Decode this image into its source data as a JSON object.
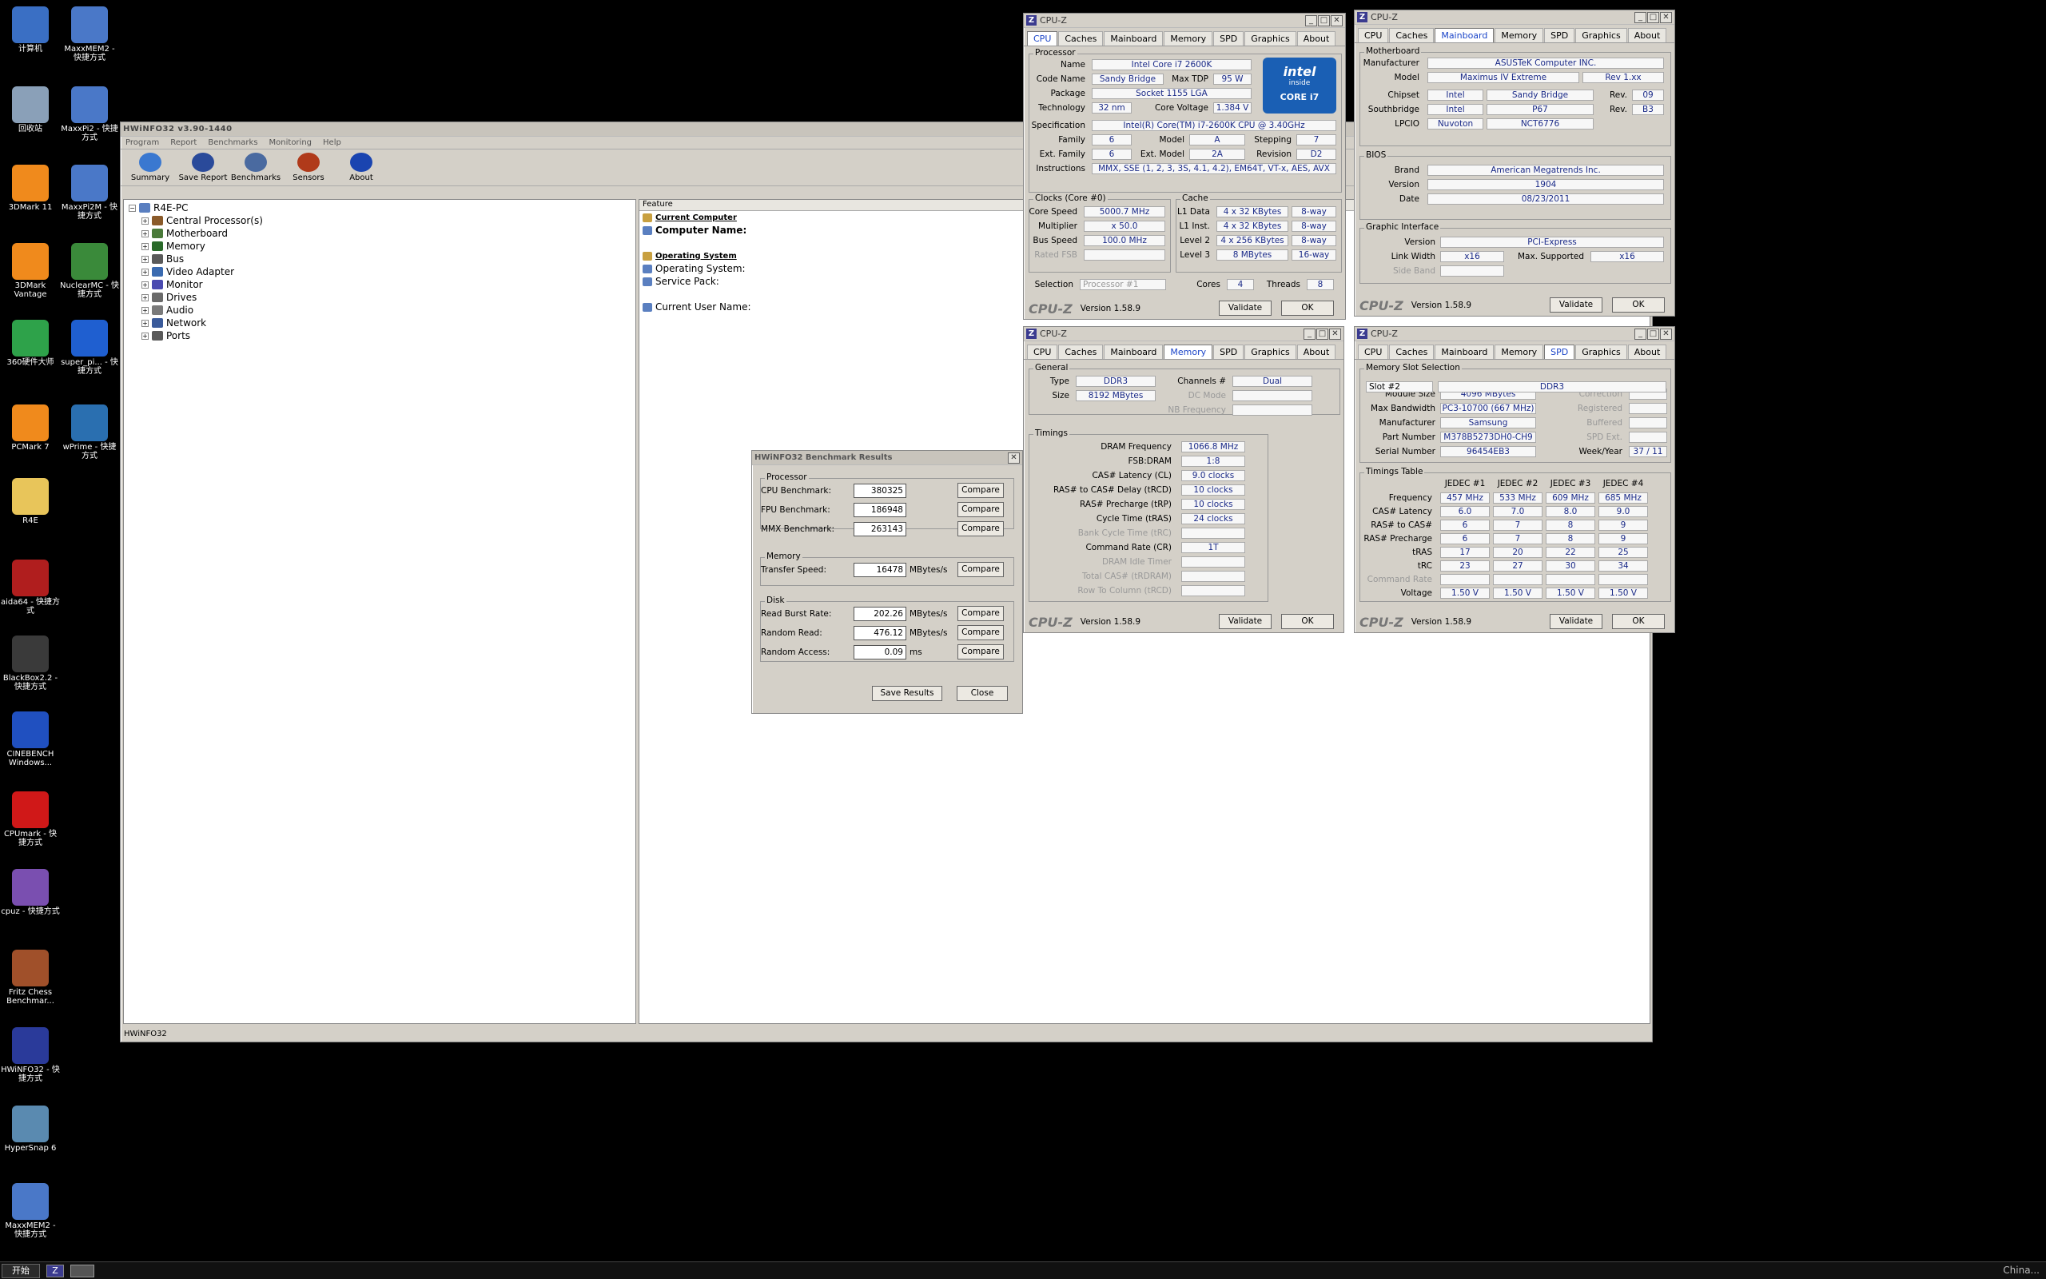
{
  "desktop": {
    "icons": [
      {
        "label": "计算机",
        "icon": "computer-icon",
        "color": "#3a6fc4"
      },
      {
        "label": "MaxxMEM2 - 快捷方式",
        "icon": "gear-icon",
        "color": "#4a78c8"
      },
      {
        "label": "回收站",
        "icon": "recycle-bin-icon",
        "color": "#8aa0b8"
      },
      {
        "label": "MaxxPi2 - 快捷方式",
        "icon": "gear-icon",
        "color": "#4a78c8"
      },
      {
        "label": "3DMark 11",
        "icon": "3dmark-icon",
        "color": "#f08a1c"
      },
      {
        "label": "MaxxPi2M - 快捷方式",
        "icon": "gear-icon",
        "color": "#4a78c8"
      },
      {
        "label": "3DMark Vantage",
        "icon": "3dmark-icon",
        "color": "#f08a1c"
      },
      {
        "label": "NuclearMC - 快捷方式",
        "icon": "nuclear-icon",
        "color": "#3a8a3a"
      },
      {
        "label": "360硬件大师",
        "icon": "search-icon",
        "color": "#2ea24a"
      },
      {
        "label": "super_pi... - 快捷方式",
        "icon": "superpi-icon",
        "color": "#1f5fd0"
      },
      {
        "label": "PCMark 7",
        "icon": "pcmark-icon",
        "color": "#f08a1c"
      },
      {
        "label": "wPrime - 快捷方式",
        "icon": "wprime-icon",
        "color": "#2a6fb0"
      },
      {
        "label": "R4E",
        "icon": "folder-icon",
        "color": "#e8c55a"
      },
      {
        "label": "aida64 - 快捷方式",
        "icon": "aida64-icon",
        "color": "#b01e1e"
      },
      {
        "label": "BlackBox2.2 - 快捷方式",
        "icon": "chart-icon",
        "color": "#3a3a3a"
      },
      {
        "label": "CINEBENCH Windows...",
        "icon": "cinebench-icon",
        "color": "#2050c0"
      },
      {
        "label": "CPUmark - 快捷方式",
        "icon": "zd-icon",
        "color": "#d01818"
      },
      {
        "label": "cpuz - 快捷方式",
        "icon": "cpuz-icon",
        "color": "#7a4fb0"
      },
      {
        "label": "Fritz Chess Benchmar...",
        "icon": "chess-icon",
        "color": "#a0502a"
      },
      {
        "label": "HWiNFO32 - 快捷方式",
        "icon": "hwinfo-icon",
        "color": "#2a3a9a"
      },
      {
        "label": "HyperSnap 6",
        "icon": "camera-icon",
        "color": "#5a8ab0"
      },
      {
        "label": "MaxxMEM2 - 快捷方式",
        "icon": "gear-icon",
        "color": "#4a78c8"
      }
    ]
  },
  "taskbar": {
    "start": "开始",
    "clock": "China..."
  },
  "hwinfo": {
    "title": "HWiNFO32 v3.90-1440",
    "menu": [
      "Program",
      "Report",
      "Benchmarks",
      "Monitoring",
      "Help"
    ],
    "toolbar": [
      "Summary",
      "Save Report",
      "Benchmarks",
      "Sensors",
      "About"
    ],
    "tree_root": "R4E-PC",
    "tree": [
      "Central Processor(s)",
      "Motherboard",
      "Memory",
      "Bus",
      "Video Adapter",
      "Monitor",
      "Drives",
      "Audio",
      "Network",
      "Ports"
    ],
    "feature_header": "Feature",
    "features": [
      {
        "text": "Current Computer",
        "bold": true
      },
      {
        "text": "Computer Name:",
        "bold": false
      },
      {
        "text": "Operating System",
        "bold": true
      },
      {
        "text": "Operating System:",
        "bold": false
      },
      {
        "text": "Service Pack:",
        "bold": false
      },
      {
        "text": "Current User Name:",
        "bold": false
      }
    ],
    "status": "HWiNFO32"
  },
  "bench": {
    "title": "HWiNFO32 Benchmark Results",
    "processor_title": "Processor",
    "processor": [
      {
        "label": "CPU Benchmark:",
        "value": "380325"
      },
      {
        "label": "FPU Benchmark:",
        "value": "186948"
      },
      {
        "label": "MMX Benchmark:",
        "value": "263143"
      }
    ],
    "memory_title": "Memory",
    "memory": [
      {
        "label": "Transfer Speed:",
        "value": "16478",
        "unit": "MBytes/s"
      }
    ],
    "disk_title": "Disk",
    "disk": [
      {
        "label": "Read Burst Rate:",
        "value": "202.26",
        "unit": "MBytes/s"
      },
      {
        "label": "Random Read:",
        "value": "476.12",
        "unit": "MBytes/s"
      },
      {
        "label": "Random Access:",
        "value": "0.09",
        "unit": "ms"
      }
    ],
    "compare": "Compare",
    "save": "Save Results",
    "close": "Close"
  },
  "cpuz": {
    "title": "CPU-Z",
    "tabs": [
      "CPU",
      "Caches",
      "Mainboard",
      "Memory",
      "SPD",
      "Graphics",
      "About"
    ],
    "version": "Version 1.58.9",
    "validate": "Validate",
    "ok": "OK",
    "brand": "CPU-Z",
    "cpu": {
      "proc_title": "Processor",
      "name_l": "Name",
      "name": "Intel Core i7 2600K",
      "code_l": "Code Name",
      "code": "Sandy Bridge",
      "tdp_l": "Max TDP",
      "tdp": "95 W",
      "pkg_l": "Package",
      "pkg": "Socket 1155 LGA",
      "tech_l": "Technology",
      "tech": "32 nm",
      "volt_l": "Core Voltage",
      "volt": "1.384 V",
      "spec_l": "Specification",
      "spec": "Intel(R) Core(TM) i7-2600K CPU @ 3.40GHz",
      "fam_l": "Family",
      "fam": "6",
      "model_l": "Model",
      "model": "A",
      "step_l": "Stepping",
      "step": "7",
      "efam_l": "Ext. Family",
      "efam": "6",
      "emodel_l": "Ext. Model",
      "emodel": "2A",
      "rev_l": "Revision",
      "rev": "D2",
      "instr_l": "Instructions",
      "instr": "MMX, SSE (1, 2, 3, 3S, 4.1, 4.2), EM64T, VT-x, AES, AVX",
      "clocks_title": "Clocks (Core #0)",
      "cs_l": "Core Speed",
      "cs": "5000.7 MHz",
      "mul_l": "Multiplier",
      "mul": "x 50.0",
      "bus_l": "Bus Speed",
      "bus": "100.0 MHz",
      "fsb_l": "Rated FSB",
      "cache_title": "Cache",
      "l1d_l": "L1 Data",
      "l1d": "4 x 32 KBytes",
      "l1d_w": "8-way",
      "l1i_l": "L1 Inst.",
      "l1i": "4 x 32 KBytes",
      "l1i_w": "8-way",
      "l2_l": "Level 2",
      "l2": "4 x 256 KBytes",
      "l2_w": "8-way",
      "l3_l": "Level 3",
      "l3": "8 MBytes",
      "l3_w": "16-way",
      "sel_l": "Selection",
      "sel": "Processor #1",
      "cores_l": "Cores",
      "cores": "4",
      "thr_l": "Threads",
      "thr": "8",
      "badge_top": "intel",
      "badge_inside": "inside",
      "badge_bottom": "CORE i7"
    },
    "mb": {
      "mb_title": "Motherboard",
      "man_l": "Manufacturer",
      "man": "ASUSTeK Computer INC.",
      "model_l": "Model",
      "model": "Maximus IV Extreme",
      "mrev": "Rev 1.xx",
      "chip_l": "Chipset",
      "chip": "Intel",
      "chip2": "Sandy Bridge",
      "crev_l": "Rev.",
      "crev": "09",
      "sb_l": "Southbridge",
      "sb": "Intel",
      "sb2": "P67",
      "sbrev": "B3",
      "lpc_l": "LPCIO",
      "lpc": "Nuvoton",
      "lpc2": "NCT6776",
      "bios_title": "BIOS",
      "brand_l": "Brand",
      "brand": "American Megatrends Inc.",
      "ver_l": "Version",
      "ver": "1904",
      "date_l": "Date",
      "date": "08/23/2011",
      "gi_title": "Graphic Interface",
      "gver_l": "Version",
      "gver": "PCI-Express",
      "lw_l": "Link Width",
      "lw": "x16",
      "ms_l": "Max. Supported",
      "ms": "x16",
      "sband_l": "Side Band"
    },
    "mem": {
      "gen_title": "General",
      "type_l": "Type",
      "type": "DDR3",
      "ch_l": "Channels #",
      "ch": "Dual",
      "size_l": "Size",
      "size": "8192 MBytes",
      "dc_l": "DC Mode",
      "nb_l": "NB Frequency",
      "tim_title": "Timings",
      "rows": [
        {
          "l": "DRAM Frequency",
          "v": "1066.8 MHz",
          "d": false
        },
        {
          "l": "FSB:DRAM",
          "v": "1:8",
          "d": false
        },
        {
          "l": "CAS# Latency (CL)",
          "v": "9.0 clocks",
          "d": false
        },
        {
          "l": "RAS# to CAS# Delay (tRCD)",
          "v": "10 clocks",
          "d": false
        },
        {
          "l": "RAS# Precharge (tRP)",
          "v": "10 clocks",
          "d": false
        },
        {
          "l": "Cycle Time (tRAS)",
          "v": "24 clocks",
          "d": false
        },
        {
          "l": "Bank Cycle Time (tRC)",
          "v": "",
          "d": true
        },
        {
          "l": "Command Rate (CR)",
          "v": "1T",
          "d": false
        },
        {
          "l": "DRAM Idle Timer",
          "v": "",
          "d": true
        },
        {
          "l": "Total CAS# (tRDRAM)",
          "v": "",
          "d": true
        },
        {
          "l": "Row To Column (tRCD)",
          "v": "",
          "d": true
        }
      ]
    },
    "spd": {
      "slot_title": "Memory Slot Selection",
      "slot": "Slot #2",
      "slot_type": "DDR3",
      "left": [
        {
          "l": "Module Size",
          "v": "4096 MBytes"
        },
        {
          "l": "Max Bandwidth",
          "v": "PC3-10700 (667 MHz)"
        },
        {
          "l": "Manufacturer",
          "v": "Samsung"
        },
        {
          "l": "Part Number",
          "v": "M378B5273DH0-CH9"
        },
        {
          "l": "Serial Number",
          "v": "96454EB3"
        }
      ],
      "right": [
        {
          "l": "Correction",
          "v": ""
        },
        {
          "l": "Registered",
          "v": ""
        },
        {
          "l": "Buffered",
          "v": ""
        },
        {
          "l": "SPD Ext.",
          "v": ""
        },
        {
          "l": "Week/Year",
          "v": "37 / 11"
        }
      ],
      "tt_title": "Timings Table",
      "cols": [
        "JEDEC #1",
        "JEDEC #2",
        "JEDEC #3",
        "JEDEC #4"
      ],
      "trows": [
        {
          "l": "Frequency",
          "v": [
            "457 MHz",
            "533 MHz",
            "609 MHz",
            "685 MHz"
          ]
        },
        {
          "l": "CAS# Latency",
          "v": [
            "6.0",
            "7.0",
            "8.0",
            "9.0"
          ]
        },
        {
          "l": "RAS# to CAS#",
          "v": [
            "6",
            "7",
            "8",
            "9"
          ]
        },
        {
          "l": "RAS# Precharge",
          "v": [
            "6",
            "7",
            "8",
            "9"
          ]
        },
        {
          "l": "tRAS",
          "v": [
            "17",
            "20",
            "22",
            "25"
          ]
        },
        {
          "l": "tRC",
          "v": [
            "23",
            "27",
            "30",
            "34"
          ]
        },
        {
          "l": "Command Rate",
          "v": [
            "",
            "",
            "",
            ""
          ]
        },
        {
          "l": "Voltage",
          "v": [
            "1.50 V",
            "1.50 V",
            "1.50 V",
            "1.50 V"
          ]
        }
      ]
    }
  }
}
